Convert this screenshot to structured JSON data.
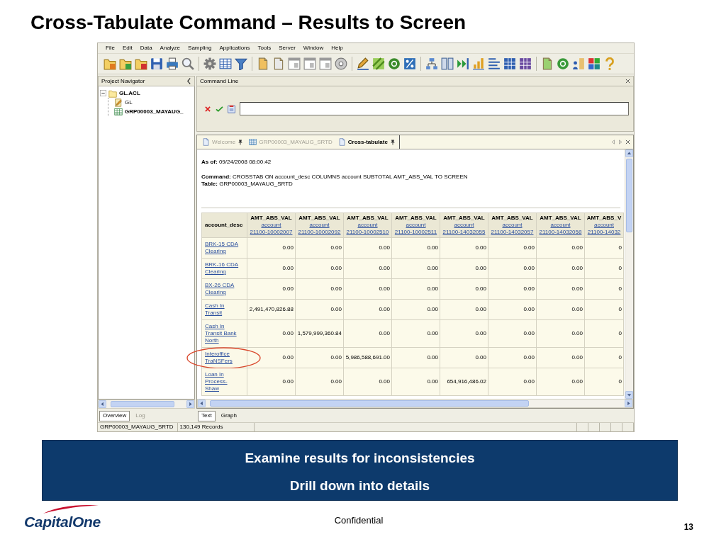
{
  "title": "Cross-Tabulate Command – Results to Screen",
  "app": {
    "menu": [
      "File",
      "Edit",
      "Data",
      "Analyze",
      "Sampling",
      "Applications",
      "Tools",
      "Server",
      "Window",
      "Help"
    ],
    "navigator": {
      "title": "Project Navigator",
      "tree": [
        {
          "label": "GL.ACL",
          "kind": "project",
          "open": true,
          "expanded": true,
          "children": [
            {
              "label": "GL",
              "kind": "workspace",
              "open": false
            },
            {
              "label": "GRP00003_MAYAUG_",
              "kind": "table",
              "open": true
            }
          ]
        }
      ],
      "tabs": [
        {
          "label": "Overview",
          "selected": true
        },
        {
          "label": "Log",
          "selected": false
        }
      ]
    },
    "command_line": {
      "title": "Command Line"
    },
    "doc_tabs": [
      {
        "label": "Welcome",
        "kind": "page",
        "selected": false,
        "pinned": true
      },
      {
        "label": "GRP00003_MAYAUG_SRTD",
        "kind": "table",
        "selected": false,
        "pinned": false
      },
      {
        "label": "Cross-tabulate",
        "kind": "page",
        "selected": true,
        "pinned": true
      }
    ],
    "report": {
      "as_of": "**As of:** 09/24/2008 08:00:42",
      "command": "**Command:** CROSSTAB ON account_desc COLUMNS account SUBTOTAL AMT_ABS_VAL TO SCREEN",
      "table": "**Table:** GRP00003_MAYAUG_SRTD"
    },
    "crosstab": {
      "row_header": "account_desc",
      "columns": [
        {
          "measure": "AMT_ABS_VAL",
          "field": "account",
          "value": "21100-10002007"
        },
        {
          "measure": "AMT_ABS_VAL",
          "field": "account",
          "value": "21100-10002092"
        },
        {
          "measure": "AMT_ABS_VAL",
          "field": "account",
          "value": "21100-10002510"
        },
        {
          "measure": "AMT_ABS_VAL",
          "field": "account",
          "value": "21100-10002511"
        },
        {
          "measure": "AMT_ABS_VAL",
          "field": "account",
          "value": "21100-14032055"
        },
        {
          "measure": "AMT_ABS_VAL",
          "field": "account",
          "value": "21100-14032057"
        },
        {
          "measure": "AMT_ABS_VAL",
          "field": "account",
          "value": "21100-14032058"
        },
        {
          "measure": "AMT_ABS_V",
          "field": "account",
          "value": "21100-14032"
        }
      ],
      "rows": [
        {
          "label": "BRK-15 CDA Clearing",
          "circled": false,
          "cells": [
            "0.00",
            "0.00",
            "0.00",
            "0.00",
            "0.00",
            "0.00",
            "0.00",
            "0"
          ]
        },
        {
          "label": "BRK-16 CDA Clearing",
          "circled": false,
          "cells": [
            "0.00",
            "0.00",
            "0.00",
            "0.00",
            "0.00",
            "0.00",
            "0.00",
            "0"
          ]
        },
        {
          "label": "BX-26 CDA Clearing",
          "circled": false,
          "cells": [
            "0.00",
            "0.00",
            "0.00",
            "0.00",
            "0.00",
            "0.00",
            "0.00",
            "0"
          ]
        },
        {
          "label": "Cash In Transit",
          "circled": false,
          "cells": [
            "2,491,470,826.88",
            "0.00",
            "0.00",
            "0.00",
            "0.00",
            "0.00",
            "0.00",
            "0"
          ]
        },
        {
          "label": "Cash In Transit Bank North",
          "circled": false,
          "cells": [
            "0.00",
            "1,579,999,360.84",
            "0.00",
            "0.00",
            "0.00",
            "0.00",
            "0.00",
            "0"
          ]
        },
        {
          "label": "Interoffice TraNSFers",
          "circled": true,
          "cells": [
            "0.00",
            "0.00",
            "5,986,588,691.00",
            "0.00",
            "0.00",
            "0.00",
            "0.00",
            "0"
          ]
        },
        {
          "label": "Loan In Process-Shaw",
          "circled": false,
          "cells": [
            "0.00",
            "0.00",
            "0.00",
            "0.00",
            "654,916,486.02",
            "0.00",
            "0.00",
            "0"
          ]
        }
      ]
    },
    "view_tabs": [
      {
        "label": "Text",
        "selected": true
      },
      {
        "label": "Graph",
        "selected": false
      }
    ],
    "status_bar": [
      "GRP00003_MAYAUG_SRTD",
      "130,149 Records"
    ]
  },
  "callout": [
    "Examine results for inconsistencies",
    "Drill down into details"
  ],
  "footer": {
    "logo": "CapitalOne",
    "label": "Confidential",
    "page_number": "13"
  }
}
